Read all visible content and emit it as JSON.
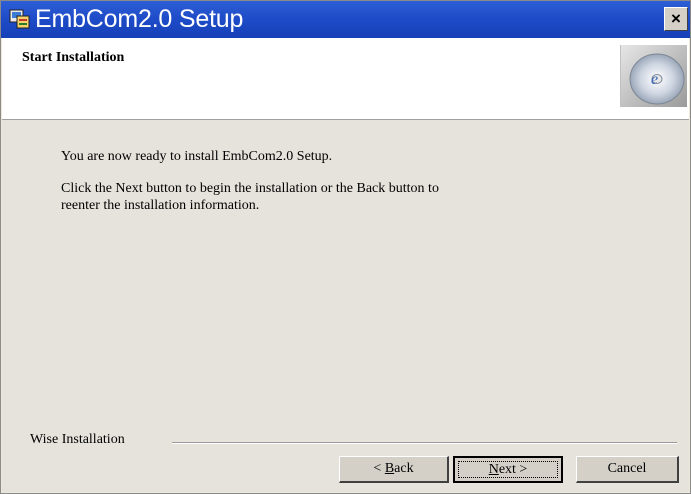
{
  "window": {
    "title": "EmbCom2.0 Setup"
  },
  "header": {
    "title": "Start Installation"
  },
  "body": {
    "line1": "You are now ready to install EmbCom2.0 Setup.",
    "line2": "Click the Next button to begin the installation or the Back button to",
    "line3": "reenter the installation information."
  },
  "footer": {
    "brand_label": "Wise Installation"
  },
  "buttons": {
    "back_prefix": "< ",
    "back_hotkey": "B",
    "back_rest": "ack",
    "next_hotkey": "N",
    "next_rest": "ext >",
    "cancel": "Cancel"
  },
  "icons": {
    "app": "installer-app-icon",
    "cd": "cd-disc-icon",
    "close": "close-icon"
  }
}
